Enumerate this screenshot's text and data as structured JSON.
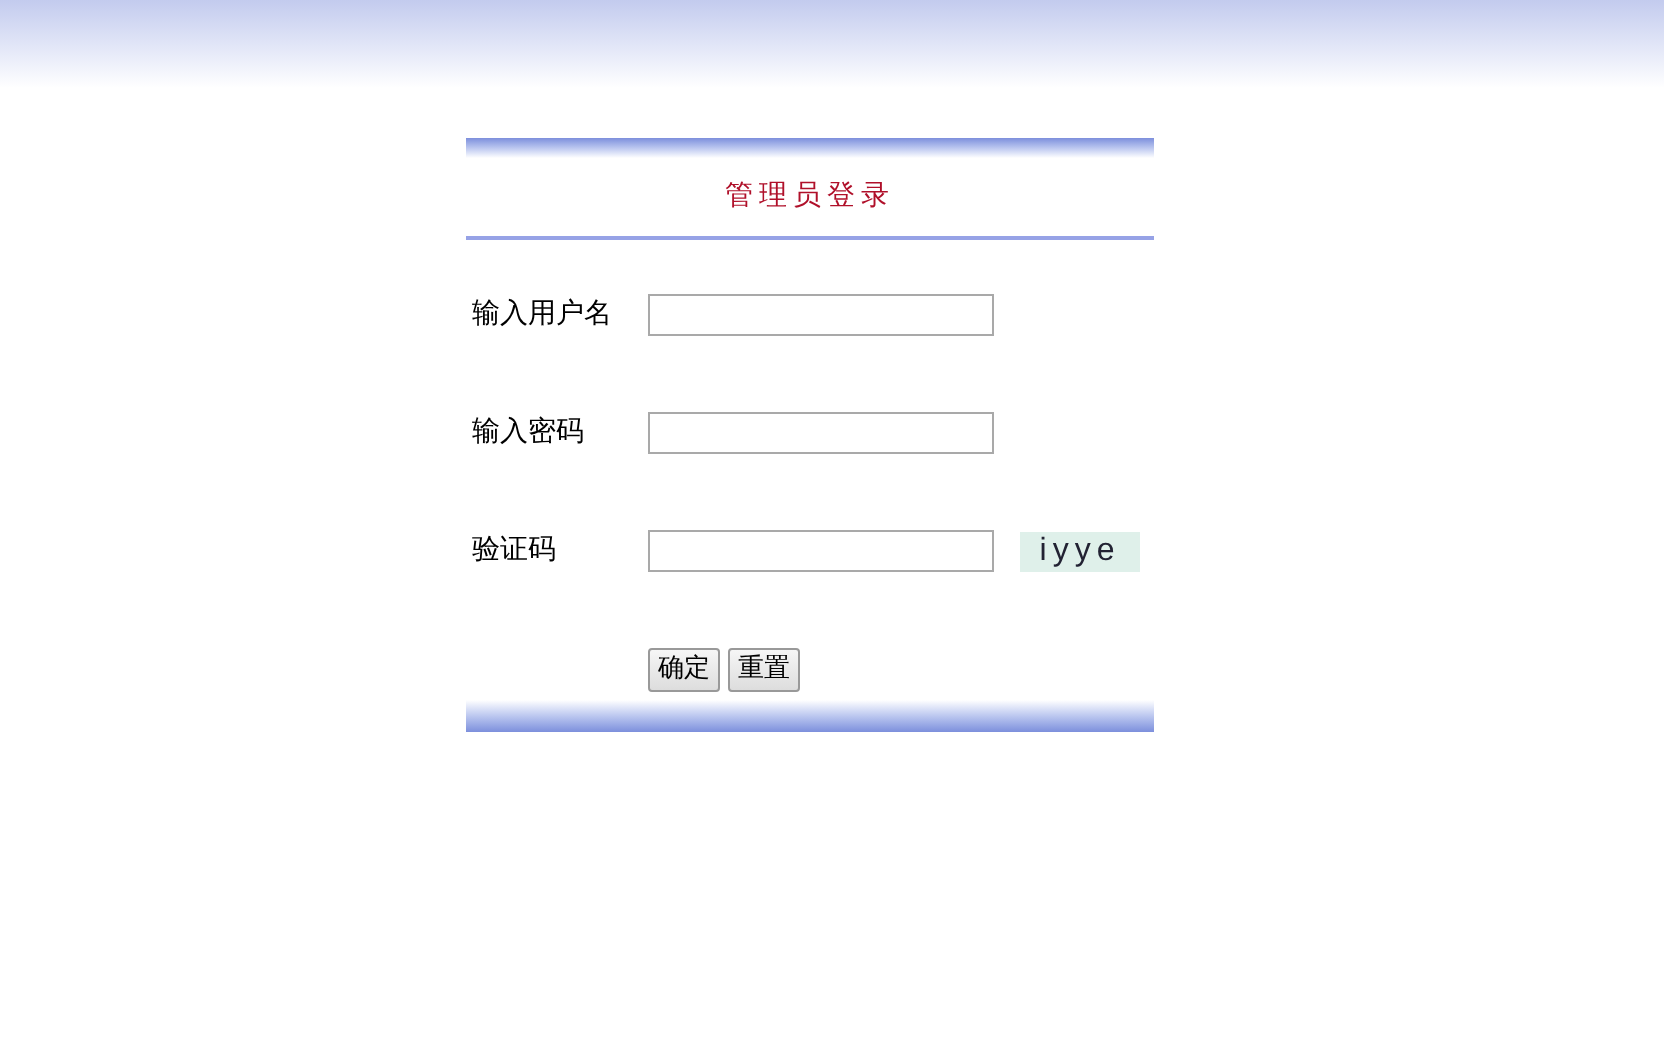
{
  "title": "管理员登录",
  "fields": [
    {
      "label": "输入用户名",
      "kind": "text"
    },
    {
      "label": "输入密码",
      "kind": "password"
    },
    {
      "label": "验证码",
      "kind": "captcha",
      "captcha": "iyye"
    }
  ],
  "buttons": [
    "确定",
    "重置"
  ]
}
